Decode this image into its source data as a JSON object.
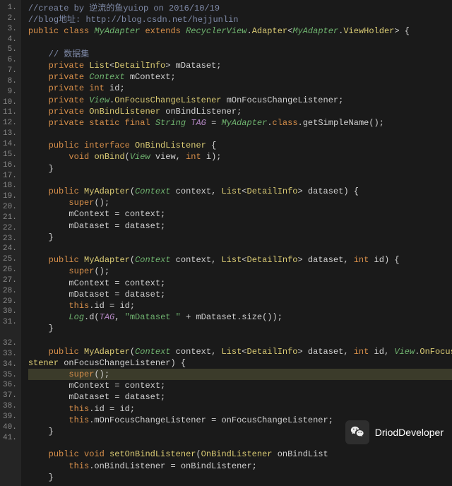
{
  "overlay": {
    "label": "DriodDeveloper"
  },
  "lines": [
    {
      "n": "1.",
      "seg": [
        [
          "c-comment",
          "//create by 逆流的鱼yuiop on 2016/10/19"
        ]
      ]
    },
    {
      "n": "2.",
      "seg": [
        [
          "c-comment",
          "//blog地址: "
        ],
        [
          "c-link",
          "http://blog.csdn.net/hejjunlin"
        ]
      ]
    },
    {
      "n": "3.",
      "seg": [
        [
          "c-keyword",
          "public class "
        ],
        [
          "c-type",
          "MyAdapter "
        ],
        [
          "c-keyword",
          "extends "
        ],
        [
          "c-type",
          "RecyclerView"
        ],
        [
          "c-text",
          "."
        ],
        [
          "c-typegen",
          "Adapter"
        ],
        [
          "c-text",
          "<"
        ],
        [
          "c-type",
          "MyAdapter"
        ],
        [
          "c-text",
          "."
        ],
        [
          "c-typegen",
          "ViewHolder"
        ],
        [
          "c-text",
          "> {"
        ]
      ]
    },
    {
      "n": "4.",
      "seg": []
    },
    {
      "n": "5.",
      "seg": [
        [
          "",
          "    "
        ],
        [
          "c-comment",
          "// 数据集"
        ]
      ]
    },
    {
      "n": "6.",
      "seg": [
        [
          "",
          "    "
        ],
        [
          "c-keyword",
          "private "
        ],
        [
          "c-typegen",
          "List"
        ],
        [
          "c-text",
          "<"
        ],
        [
          "c-typegen",
          "DetailInfo"
        ],
        [
          "c-text",
          "> mDataset;"
        ]
      ]
    },
    {
      "n": "7.",
      "seg": [
        [
          "",
          "    "
        ],
        [
          "c-keyword",
          "private "
        ],
        [
          "c-type",
          "Context "
        ],
        [
          "c-text",
          "mContext;"
        ]
      ]
    },
    {
      "n": "8.",
      "seg": [
        [
          "",
          "    "
        ],
        [
          "c-keyword",
          "private int "
        ],
        [
          "c-text",
          "id;"
        ]
      ]
    },
    {
      "n": "9.",
      "seg": [
        [
          "",
          "    "
        ],
        [
          "c-keyword",
          "private "
        ],
        [
          "c-type",
          "View"
        ],
        [
          "c-text",
          "."
        ],
        [
          "c-typegen",
          "OnFocusChangeListener "
        ],
        [
          "c-text",
          "mOnFocusChangeListener;"
        ]
      ]
    },
    {
      "n": "10.",
      "seg": [
        [
          "",
          "    "
        ],
        [
          "c-keyword",
          "private "
        ],
        [
          "c-typegen",
          "OnBindListener "
        ],
        [
          "c-text",
          "onBindListener;"
        ]
      ]
    },
    {
      "n": "11.",
      "seg": [
        [
          "",
          "    "
        ],
        [
          "c-keyword",
          "private static final "
        ],
        [
          "c-type",
          "String "
        ],
        [
          "c-static",
          "TAG"
        ],
        [
          "c-text",
          " = "
        ],
        [
          "c-type",
          "MyAdapter"
        ],
        [
          "c-text",
          "."
        ],
        [
          "c-keyword",
          "class"
        ],
        [
          "c-text",
          ".getSimpleName();"
        ]
      ]
    },
    {
      "n": "12.",
      "seg": []
    },
    {
      "n": "13.",
      "seg": [
        [
          "",
          "    "
        ],
        [
          "c-keyword",
          "public interface "
        ],
        [
          "c-typegen",
          "OnBindListener "
        ],
        [
          "c-text",
          "{"
        ]
      ]
    },
    {
      "n": "14.",
      "seg": [
        [
          "",
          "        "
        ],
        [
          "c-keyword",
          "void "
        ],
        [
          "c-method",
          "onBind"
        ],
        [
          "c-text",
          "("
        ],
        [
          "c-type",
          "View "
        ],
        [
          "c-text",
          "view, "
        ],
        [
          "c-keyword",
          "int "
        ],
        [
          "c-text",
          "i);"
        ]
      ]
    },
    {
      "n": "15.",
      "seg": [
        [
          "c-text",
          "    }"
        ]
      ]
    },
    {
      "n": "16.",
      "seg": []
    },
    {
      "n": "17.",
      "seg": [
        [
          "",
          "    "
        ],
        [
          "c-keyword",
          "public "
        ],
        [
          "c-method",
          "MyAdapter"
        ],
        [
          "c-text",
          "("
        ],
        [
          "c-type",
          "Context "
        ],
        [
          "c-text",
          "context, "
        ],
        [
          "c-typegen",
          "List"
        ],
        [
          "c-text",
          "<"
        ],
        [
          "c-typegen",
          "DetailInfo"
        ],
        [
          "c-text",
          "> dataset) {"
        ]
      ]
    },
    {
      "n": "18.",
      "seg": [
        [
          "",
          "        "
        ],
        [
          "c-keyword",
          "super"
        ],
        [
          "c-text",
          "();"
        ]
      ]
    },
    {
      "n": "19.",
      "seg": [
        [
          "c-text",
          "        mContext = context;"
        ]
      ]
    },
    {
      "n": "20.",
      "seg": [
        [
          "c-text",
          "        mDataset = dataset;"
        ]
      ]
    },
    {
      "n": "21.",
      "seg": [
        [
          "c-text",
          "    }"
        ]
      ]
    },
    {
      "n": "22.",
      "seg": []
    },
    {
      "n": "23.",
      "seg": [
        [
          "",
          "    "
        ],
        [
          "c-keyword",
          "public "
        ],
        [
          "c-method",
          "MyAdapter"
        ],
        [
          "c-text",
          "("
        ],
        [
          "c-type",
          "Context "
        ],
        [
          "c-text",
          "context, "
        ],
        [
          "c-typegen",
          "List"
        ],
        [
          "c-text",
          "<"
        ],
        [
          "c-typegen",
          "DetailInfo"
        ],
        [
          "c-text",
          "> dataset, "
        ],
        [
          "c-keyword",
          "int "
        ],
        [
          "c-text",
          "id) {"
        ]
      ]
    },
    {
      "n": "24.",
      "seg": [
        [
          "",
          "        "
        ],
        [
          "c-keyword",
          "super"
        ],
        [
          "c-text",
          "();"
        ]
      ]
    },
    {
      "n": "25.",
      "seg": [
        [
          "c-text",
          "        mContext = context;"
        ]
      ]
    },
    {
      "n": "26.",
      "seg": [
        [
          "c-text",
          "        mDataset = dataset;"
        ]
      ]
    },
    {
      "n": "27.",
      "seg": [
        [
          "",
          "        "
        ],
        [
          "c-this",
          "this"
        ],
        [
          "c-text",
          ".id = id;"
        ]
      ]
    },
    {
      "n": "28.",
      "seg": [
        [
          "",
          "        "
        ],
        [
          "c-type",
          "Log"
        ],
        [
          "c-text",
          ".d("
        ],
        [
          "c-static",
          "TAG"
        ],
        [
          "c-text",
          ", "
        ],
        [
          "c-string",
          "\"mDataset \""
        ],
        [
          "c-text",
          " + mDataset.size());"
        ]
      ]
    },
    {
      "n": "29.",
      "seg": [
        [
          "c-text",
          "    }"
        ]
      ]
    },
    {
      "n": "30.",
      "seg": []
    },
    {
      "n": "31.",
      "seg": [
        [
          "",
          "    "
        ],
        [
          "c-keyword",
          "public "
        ],
        [
          "c-method",
          "MyAdapter"
        ],
        [
          "c-text",
          "("
        ],
        [
          "c-type",
          "Context "
        ],
        [
          "c-text",
          "context, "
        ],
        [
          "c-typegen",
          "List"
        ],
        [
          "c-text",
          "<"
        ],
        [
          "c-typegen",
          "DetailInfo"
        ],
        [
          "c-text",
          "> dataset, "
        ],
        [
          "c-keyword",
          "int "
        ],
        [
          "c-text",
          "id, "
        ],
        [
          "c-type",
          "View"
        ],
        [
          "c-text",
          "."
        ],
        [
          "c-typegen",
          "OnFocusChangeLi"
        ]
      ]
    },
    {
      "n": "",
      "wrap": true,
      "seg": [
        [
          "c-typegen",
          "stener "
        ],
        [
          "c-text",
          "onFocusChangeListener) {"
        ]
      ]
    },
    {
      "n": "32.",
      "hl": true,
      "seg": [
        [
          "",
          "        "
        ],
        [
          "c-keyword",
          "super"
        ],
        [
          "c-text",
          "();"
        ]
      ]
    },
    {
      "n": "33.",
      "seg": [
        [
          "c-text",
          "        mContext = context;"
        ]
      ]
    },
    {
      "n": "34.",
      "seg": [
        [
          "c-text",
          "        mDataset = dataset;"
        ]
      ]
    },
    {
      "n": "35.",
      "seg": [
        [
          "",
          "        "
        ],
        [
          "c-this",
          "this"
        ],
        [
          "c-text",
          ".id = id;"
        ]
      ]
    },
    {
      "n": "36.",
      "seg": [
        [
          "",
          "        "
        ],
        [
          "c-this",
          "this"
        ],
        [
          "c-text",
          ".mOnFocusChangeListener = onFocusChangeListener;"
        ]
      ]
    },
    {
      "n": "37.",
      "seg": [
        [
          "c-text",
          "    }"
        ]
      ]
    },
    {
      "n": "38.",
      "seg": []
    },
    {
      "n": "39.",
      "seg": [
        [
          "",
          "    "
        ],
        [
          "c-keyword",
          "public void "
        ],
        [
          "c-method",
          "setOnBindListener"
        ],
        [
          "c-text",
          "("
        ],
        [
          "c-typegen",
          "OnBindListener "
        ],
        [
          "c-text",
          "onBindList"
        ]
      ]
    },
    {
      "n": "40.",
      "seg": [
        [
          "",
          "        "
        ],
        [
          "c-this",
          "this"
        ],
        [
          "c-text",
          ".onBindListener = onBindListener;"
        ]
      ]
    },
    {
      "n": "41.",
      "seg": [
        [
          "c-text",
          "    }"
        ]
      ]
    }
  ]
}
